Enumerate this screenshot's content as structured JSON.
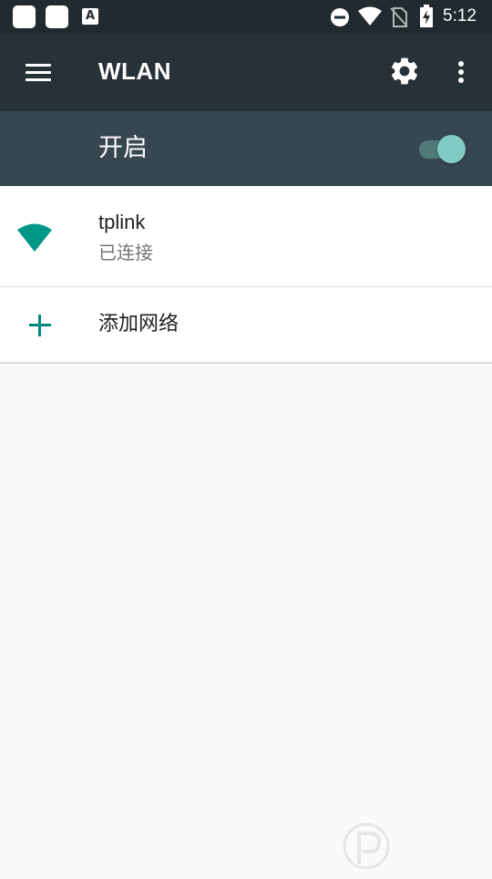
{
  "status_bar": {
    "time": "5:12",
    "icons": [
      "app-square-icon",
      "app-square-icon",
      "accessibility-a-icon",
      "do-not-disturb-icon",
      "wifi-signal-icon",
      "no-sim-icon",
      "battery-charging-icon"
    ],
    "accessibility_letter": "A"
  },
  "toolbar": {
    "title": "WLAN",
    "menu_icon": "menu-icon",
    "settings_icon": "gear-icon",
    "more_icon": "more-vert-icon"
  },
  "switch_bar": {
    "label": "开启",
    "enabled": true
  },
  "networks": [
    {
      "name": "tplink",
      "status": "已连接",
      "icon": "wifi-icon"
    }
  ],
  "add_network": {
    "label": "添加网络",
    "icon": "plus-icon"
  },
  "colors": {
    "status_bar": "#202a2f",
    "toolbar": "#263238",
    "switch_bar": "#37474f",
    "accent": "#009688",
    "toggle_thumb": "#80cbc4",
    "background": "#fafafa"
  }
}
